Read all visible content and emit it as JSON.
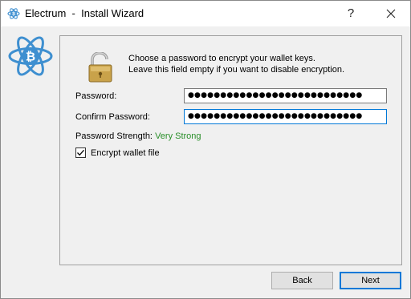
{
  "window": {
    "app_name": "Electrum",
    "separator": "-",
    "title": "Install Wizard",
    "help_label": "?"
  },
  "intro": {
    "line1": "Choose a password to encrypt your wallet keys.",
    "line2": "Leave this field empty if you want to disable encryption."
  },
  "form": {
    "password_label": "Password:",
    "password_value": "●●●●●●●●●●●●●●●●●●●●●●●●●●●",
    "confirm_label": "Confirm Password:",
    "confirm_value": "●●●●●●●●●●●●●●●●●●●●●●●●●●●",
    "strength_label": "Password Strength:",
    "strength_value": "Very Strong",
    "encrypt_label": "Encrypt wallet file",
    "encrypt_checked": true
  },
  "buttons": {
    "back": "Back",
    "next": "Next"
  },
  "colors": {
    "accent": "#0078d7",
    "strength": "#2a8f2a",
    "logo_blue": "#3e8fd0"
  },
  "icons": {
    "title": "electrum-logo-icon",
    "logo": "electrum-logo-icon",
    "lock": "padlock-icon",
    "check": "checkmark-icon",
    "close": "close-icon"
  }
}
